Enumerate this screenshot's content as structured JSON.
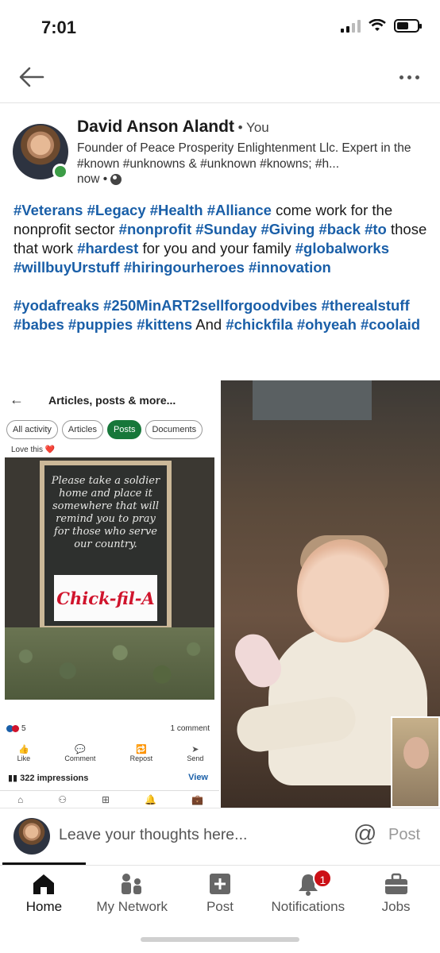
{
  "status_bar": {
    "time": "7:01"
  },
  "post": {
    "author": "David Anson Alandt",
    "author_suffix": " • You",
    "headline": "Founder of Peace Prosperity Enlightenment Llc. Expert in the #known #unknowns & #unknown #knowns; #h...",
    "time": "now •",
    "text_blocks": [
      [
        {
          "t": "#Veterans #Legacy #Health #Alliance",
          "tag": true
        },
        {
          "t": " come  work for the nonprofit sector ",
          "tag": false
        },
        {
          "t": "#nonprofit #Sunday #Giving #back #to",
          "tag": true
        },
        {
          "t": " those that work ",
          "tag": false
        },
        {
          "t": "#hardest",
          "tag": true
        },
        {
          "t": " for you and your family ",
          "tag": false
        },
        {
          "t": "#globalworks #willbuyUrstuff #hiringourheroes #innovation",
          "tag": true
        }
      ],
      [
        {
          "t": "#yodafreaks #250MinART2sellforgoodvibes #therealstuff #babes #puppies #kittens",
          "tag": true
        },
        {
          "t": " And ",
          "tag": false
        },
        {
          "t": "#chickfila #ohyeah #coolaid",
          "tag": true
        }
      ]
    ]
  },
  "embedded_screenshot": {
    "back": "←",
    "title": "Articles, posts & more...",
    "tabs": [
      "All activity",
      "Articles",
      "Posts",
      "Documents"
    ],
    "active_tab": "Posts",
    "caption": "Love this ❤️",
    "chalkboard_text": "Please take a soldier home and place it somewhere that will remind you to pray for those who serve our country.",
    "logo_text": "Chick-fil-A",
    "reaction_count": "5",
    "comments": "1 comment",
    "actions": [
      {
        "label": "Like",
        "icon": "👍"
      },
      {
        "label": "Comment",
        "icon": "💬"
      },
      {
        "label": "Repost",
        "icon": "🔁"
      },
      {
        "label": "Send",
        "icon": "➤"
      }
    ],
    "impressions": "322 impressions",
    "view": "View"
  },
  "comment_bar": {
    "placeholder": "Leave your thoughts here...",
    "at": "@",
    "post": "Post"
  },
  "bottom_nav": {
    "items": [
      {
        "label": "Home",
        "icon": "home-icon"
      },
      {
        "label": "My Network",
        "icon": "network-icon"
      },
      {
        "label": "Post",
        "icon": "post-icon"
      },
      {
        "label": "Notifications",
        "icon": "bell-icon",
        "badge": "1"
      },
      {
        "label": "Jobs",
        "icon": "briefcase-icon"
      }
    ],
    "active": "Home"
  },
  "colors": {
    "hashtag": "#1a5fa8",
    "online": "#3c9d46",
    "active_tab": "#17773a",
    "badge": "#cc1016"
  }
}
